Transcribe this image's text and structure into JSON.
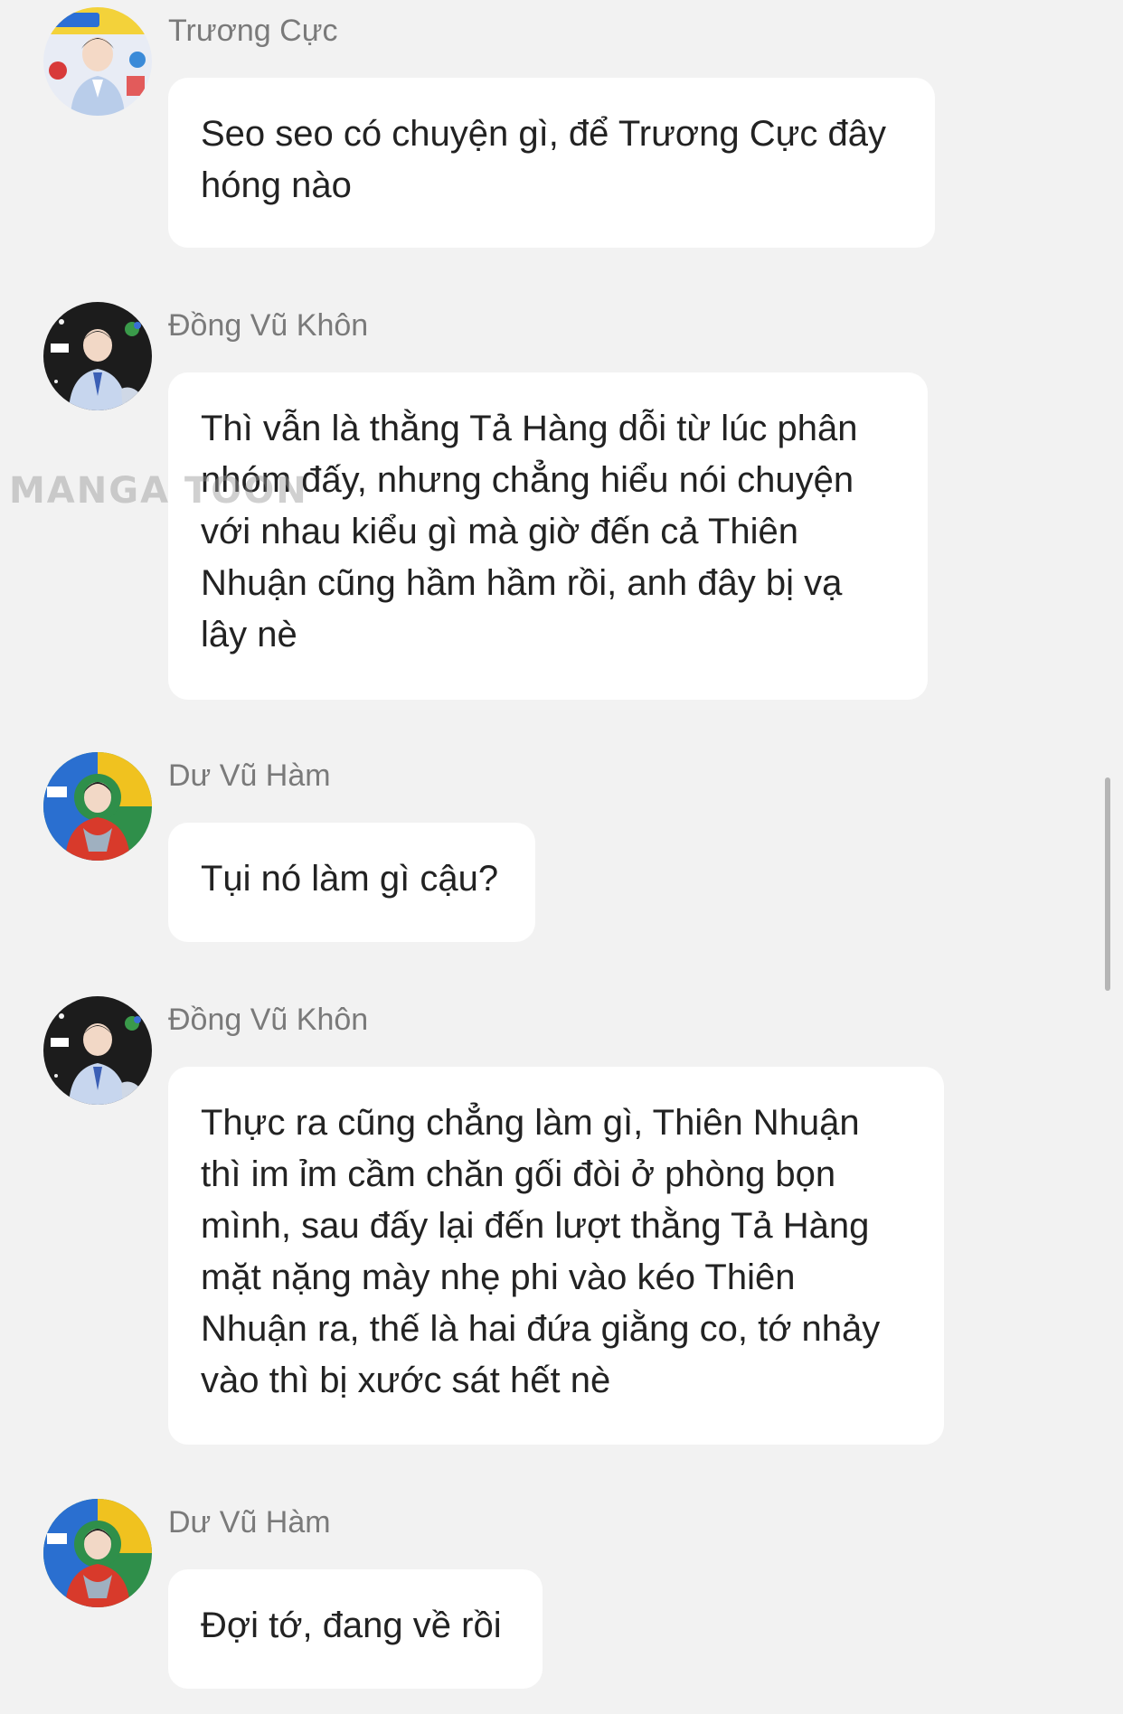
{
  "watermark": "MANGA TOON",
  "messages": [
    {
      "sender": "Trương Cực",
      "text": "Seo seo có chuyện gì, để Trương Cực đây\nhóng nào",
      "avatar_icon": "avatar-truong-cuc-icon"
    },
    {
      "sender": "Đồng Vũ Khôn",
      "text": "Thì vẫn là thằng Tả Hàng dỗi từ lúc phân\nnhóm đấy, nhưng chẳng hiểu nói chuyện\nvới nhau kiểu gì mà giờ đến cả Thiên\nNhuận cũng hầm hầm rồi, anh đây bị vạ\nlây nè",
      "avatar_icon": "avatar-dong-vu-khon-icon"
    },
    {
      "sender": "Dư Vũ Hàm",
      "text": "Tụi nó làm gì cậu?",
      "avatar_icon": "avatar-du-vu-ham-icon"
    },
    {
      "sender": "Đồng Vũ Khôn",
      "text": "Thực ra cũng chẳng làm gì, Thiên Nhuận\nthì im ỉm cầm chăn gối đòi ở phòng bọn\nmình, sau đấy lại đến lượt thằng Tả Hàng\nmặt nặng mày nhẹ phi vào kéo Thiên\nNhuận ra, thế là hai đứa giằng co, tớ nhảy\nvào thì bị xước sát hết nè",
      "avatar_icon": "avatar-dong-vu-khon-icon"
    },
    {
      "sender": "Dư Vũ Hàm",
      "text": "Đợi tớ, đang về rồi",
      "avatar_icon": "avatar-du-vu-ham-icon"
    }
  ]
}
